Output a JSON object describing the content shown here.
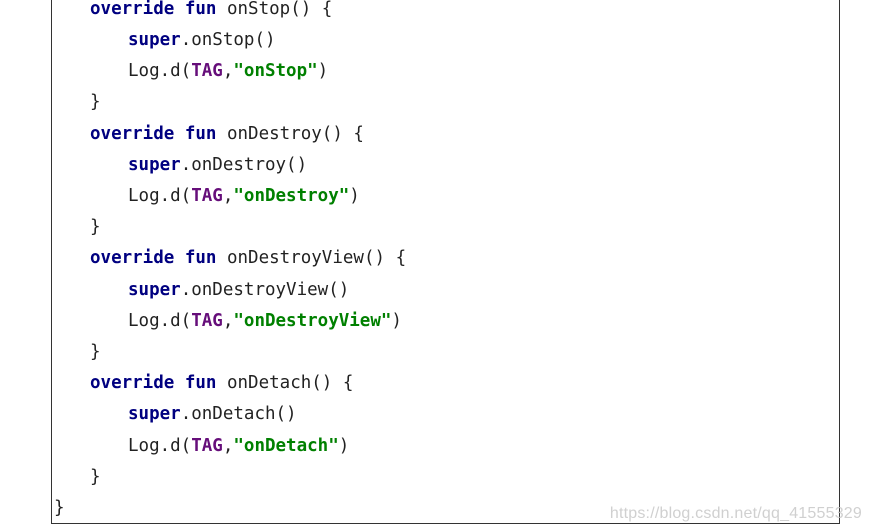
{
  "code": {
    "lines": [
      {
        "parts": [
          {
            "t": "kw",
            "v": "override"
          },
          {
            "t": "plain",
            "v": " "
          },
          {
            "t": "kw",
            "v": "fun"
          },
          {
            "t": "plain",
            "v": " onStop() {"
          }
        ]
      },
      {
        "parts": [
          {
            "t": "kw",
            "v": "super"
          },
          {
            "t": "plain",
            "v": ".onStop()"
          }
        ]
      },
      {
        "parts": [
          {
            "t": "plain",
            "v": "Log.d("
          },
          {
            "t": "tag",
            "v": "TAG"
          },
          {
            "t": "plain",
            "v": ","
          },
          {
            "t": "str",
            "v": "\"onStop\""
          },
          {
            "t": "plain",
            "v": ")"
          }
        ]
      },
      {
        "parts": [
          {
            "t": "plain",
            "v": "}"
          }
        ]
      },
      {
        "parts": [
          {
            "t": "kw",
            "v": "override"
          },
          {
            "t": "plain",
            "v": " "
          },
          {
            "t": "kw",
            "v": "fun"
          },
          {
            "t": "plain",
            "v": " onDestroy() {"
          }
        ]
      },
      {
        "parts": [
          {
            "t": "kw",
            "v": "super"
          },
          {
            "t": "plain",
            "v": ".onDestroy()"
          }
        ]
      },
      {
        "parts": [
          {
            "t": "plain",
            "v": "Log.d("
          },
          {
            "t": "tag",
            "v": "TAG"
          },
          {
            "t": "plain",
            "v": ","
          },
          {
            "t": "str",
            "v": "\"onDestroy\""
          },
          {
            "t": "plain",
            "v": ")"
          }
        ]
      },
      {
        "parts": [
          {
            "t": "plain",
            "v": "}"
          }
        ]
      },
      {
        "parts": [
          {
            "t": "kw",
            "v": "override"
          },
          {
            "t": "plain",
            "v": " "
          },
          {
            "t": "kw",
            "v": "fun"
          },
          {
            "t": "plain",
            "v": " onDestroyView() {"
          }
        ]
      },
      {
        "parts": [
          {
            "t": "kw",
            "v": "super"
          },
          {
            "t": "plain",
            "v": ".onDestroyView()"
          }
        ]
      },
      {
        "parts": [
          {
            "t": "plain",
            "v": "Log.d("
          },
          {
            "t": "tag",
            "v": "TAG"
          },
          {
            "t": "plain",
            "v": ","
          },
          {
            "t": "str",
            "v": "\"onDestroyView\""
          },
          {
            "t": "plain",
            "v": ")"
          }
        ]
      },
      {
        "parts": [
          {
            "t": "plain",
            "v": "}"
          }
        ]
      },
      {
        "parts": [
          {
            "t": "kw",
            "v": "override"
          },
          {
            "t": "plain",
            "v": " "
          },
          {
            "t": "kw",
            "v": "fun"
          },
          {
            "t": "plain",
            "v": " onDetach() {"
          }
        ]
      },
      {
        "parts": [
          {
            "t": "kw",
            "v": "super"
          },
          {
            "t": "plain",
            "v": ".onDetach()"
          }
        ]
      },
      {
        "parts": [
          {
            "t": "plain",
            "v": "Log.d("
          },
          {
            "t": "tag",
            "v": "TAG"
          },
          {
            "t": "plain",
            "v": ","
          },
          {
            "t": "str",
            "v": "\"onDetach\""
          },
          {
            "t": "plain",
            "v": ")"
          }
        ]
      },
      {
        "parts": [
          {
            "t": "plain",
            "v": "}"
          }
        ]
      },
      {
        "parts": [
          {
            "t": "plain",
            "v": "}"
          }
        ]
      }
    ]
  },
  "watermark": "https://blog.csdn.net/qq_41555329",
  "colors": {
    "keyword": "#000080",
    "tag": "#660e7a",
    "string": "#008000"
  }
}
